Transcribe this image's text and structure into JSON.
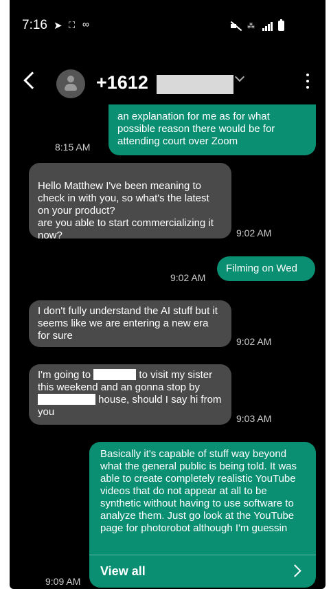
{
  "status_bar": {
    "time": "7:16",
    "icons": [
      "navigation-arrow-icon",
      "screenshot-icon",
      "voicemail-icon",
      "mute-icon",
      "wifi-icon",
      "signal-icon",
      "battery-icon"
    ]
  },
  "header": {
    "phone_number": "+1612"
  },
  "messages": [
    {
      "direction": "outgoing",
      "text": "an explanation for me as for what possible reason there would be for attending court over Zoom",
      "time": "8:15 AM"
    },
    {
      "direction": "incoming",
      "text": "Hello Matthew I've been meaning to check in with you, so what's the latest on your product?\nare you able to start commercializing it now?",
      "time": "9:02 AM"
    },
    {
      "direction": "outgoing",
      "text": "Filming on Wed",
      "time": "9:02 AM"
    },
    {
      "direction": "incoming",
      "text": "I don't fully understand the AI stuff but it seems like we are entering a new era for sure",
      "time": "9:02 AM"
    },
    {
      "direction": "incoming",
      "text_parts": [
        "I'm going to",
        "to visit my sister this weekend and an gonna stop by",
        "house, should I say hi from you"
      ],
      "time": "9:03 AM"
    },
    {
      "direction": "outgoing",
      "text": "Basically it's capable of stuff way beyond what the general public is being told.  It was able to create completely realistic YouTube videos that do not appear at all to be synthetic without having to use software to analyze them.  Just go look at the YouTube page for photorobot although I'm guessin",
      "time": "9:09 AM",
      "action_label": "View all"
    }
  ]
}
